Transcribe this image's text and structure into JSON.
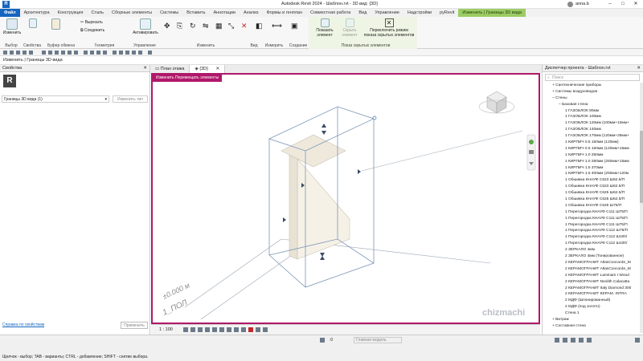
{
  "app": {
    "title": "Autodesk Revit 2024 - Шаблон.rvt - 3D вид: {3D}",
    "user": "anna.b"
  },
  "ribbon_tabs": [
    "Файл",
    "Архитектура",
    "Конструкция",
    "Сталь",
    "Сборные элементы",
    "Системы",
    "Вставить",
    "Аннотации",
    "Анализ",
    "Формы и генплан",
    "Совместная работа",
    "Вид",
    "Управление",
    "Надстройки",
    "pyRevit",
    "Изменить | Границы 3D вида"
  ],
  "ribbon": {
    "modify": "Изменить",
    "cut": "Вырезать",
    "join": "Соединить",
    "activate_ctrl": "Активировать",
    "show_element": "Показать элемент",
    "hide_element": "Скрыть элемент",
    "toggle_hidden": "Переключить режим показа скрытых элементов",
    "close_label": "✕",
    "panels": {
      "select": "Выбор",
      "properties": "Свойства",
      "clipboard": "Буфер обмена",
      "geometry": "Геометрия",
      "controls": "Управление",
      "modify": "Изменить",
      "view": "Вид",
      "measure": "Измерить",
      "create": "Создание",
      "show_hidden": "Показ скрытых элементов"
    }
  },
  "options_bar": {
    "context": "Изменить | Границы 3D вида"
  },
  "properties": {
    "title": "Свойства",
    "type_selector": "Границы 3D вида (1)",
    "edit_type": "Изменить тип",
    "help_link": "Справка по свойствам",
    "apply": "Применить"
  },
  "view_tabs": [
    {
      "label": "План этажа",
      "active": false
    },
    {
      "label": "{3D}",
      "active": true
    }
  ],
  "viewport": {
    "banner": "Изменить Перемещать элементы",
    "elevation_value": "±0.000 м",
    "level_name": "1_ПОЛ",
    "watermark": "chizmachi",
    "accent": "#b0186a"
  },
  "view_controls": {
    "scale": "1 : 100",
    "model": "Главная модель"
  },
  "browser": {
    "title": "Диспетчер проекта - Шаблон.rvt",
    "search_placeholder": "Поиск",
    "items": [
      "Сантехнические приборы",
      "Системы воздуховодов",
      "Стены",
      "Базовая стена",
      "1 ГАЗОБЛОК 80мм",
      "1 ГАЗОБЛОК 100мм",
      "1 ГАЗОБЛОК 120мм (100мм+10мм+",
      "1 ГАЗОБЛОК 140мм",
      "1 ГАЗОБЛОК 170мм (120мм+25мм+",
      "1 КИРПИЧ 0.5 150мм (120мм)",
      "1 КИРПИЧ 0.5 150мм (120мм+15мм",
      "1 КИРПИЧ 1.0 250мм",
      "1 КИРПИЧ 1.0 280мм (250мм+15мм",
      "1 КИРПИЧ 1.5 370мм",
      "1 КИРПИЧ 1.5 400мм (250мм+120м",
      "1 Обшивка КНАУФ С623 Ш62.5/П",
      "1 Обшивка КНАУФ С623 Ш62.5/П",
      "1 Обшивка КНАУФ С625 Ш62.5/П",
      "1 Обшивка КНАУФ С625 Ш62.5/П",
      "1 Обшивка КНАУФ С626 Ш75/П",
      "1 Перегородка КНАУФ С111 Ш75/П",
      "1 Перегородка КНАУФ С111 Ш75/П",
      "1 Перегородка КНАУФ С111 Ш75/П",
      "1 Перегородка КНАУФ С112 Ш75/П",
      "1 Перегородка КНАУФ С112 Ш100/",
      "1 Перегородка КНАУФ С112 Ш100/",
      "2 ЗЕРКАЛО 4мм",
      "2 ЗЕРКАЛО 4мм (Тонированное)",
      "2 КЕРАМОГРАНИТ AtlasConcorde_M",
      "2 КЕРАМОГРАНИТ AtlasConcorde_M",
      "2 КЕРАМОГРАНИТ Laminam I Wood",
      "2 КЕРАМОГРАНИТ Neolith Calacatta",
      "2 КЕРАМОГРАНИТ Italy Diamond 300",
      "2 КЕРАМОГРАНИТ КЕРАМ. INTRA",
      "2 МДФ (Шпонированный)",
      "2 МДФ (под золото)",
      "Стена 1",
      "Витраж",
      "Составная стена"
    ]
  },
  "status": {
    "hint": "Щелчок - выбор; TAB - варианты; CTRL - добавление; SHIFT - снятие выбора.",
    "model": "Главная модель",
    "zoom": ":0"
  }
}
